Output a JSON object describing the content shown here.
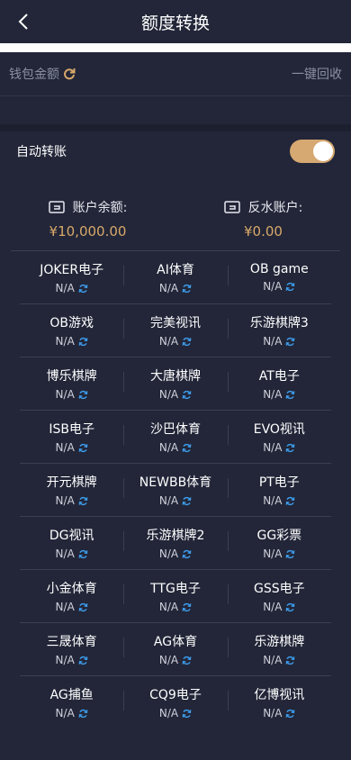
{
  "header": {
    "title": "额度转换"
  },
  "wallet": {
    "label": "钱包金额",
    "recycle": "一键回收"
  },
  "auto_transfer": {
    "label": "自动转账",
    "enabled": true
  },
  "accounts": [
    {
      "label": "账户余额:",
      "value": "¥10,000.00"
    },
    {
      "label": "反水账户:",
      "value": "¥0.00"
    }
  ],
  "colors": {
    "accent": "#d9a86a",
    "toggle": "#d6a872",
    "refresh_icon": "#3d9be9",
    "background": "#222638"
  },
  "platforms": [
    [
      {
        "name": "JOKER电子",
        "value": "N/A"
      },
      {
        "name": "AI体育",
        "value": "N/A"
      },
      {
        "name": "OB game",
        "value": "N/A"
      }
    ],
    [
      {
        "name": "OB游戏",
        "value": "N/A"
      },
      {
        "name": "完美视讯",
        "value": "N/A"
      },
      {
        "name": "乐游棋牌3",
        "value": "N/A"
      }
    ],
    [
      {
        "name": "博乐棋牌",
        "value": "N/A"
      },
      {
        "name": "大唐棋牌",
        "value": "N/A"
      },
      {
        "name": "AT电子",
        "value": "N/A"
      }
    ],
    [
      {
        "name": "ISB电子",
        "value": "N/A"
      },
      {
        "name": "沙巴体育",
        "value": "N/A"
      },
      {
        "name": "EVO视讯",
        "value": "N/A"
      }
    ],
    [
      {
        "name": "开元棋牌",
        "value": "N/A"
      },
      {
        "name": "NEWBB体育",
        "value": "N/A"
      },
      {
        "name": "PT电子",
        "value": "N/A"
      }
    ],
    [
      {
        "name": "DG视讯",
        "value": "N/A"
      },
      {
        "name": "乐游棋牌2",
        "value": "N/A"
      },
      {
        "name": "GG彩票",
        "value": "N/A"
      }
    ],
    [
      {
        "name": "小金体育",
        "value": "N/A"
      },
      {
        "name": "TTG电子",
        "value": "N/A"
      },
      {
        "name": "GSS电子",
        "value": "N/A"
      }
    ],
    [
      {
        "name": "三晟体育",
        "value": "N/A"
      },
      {
        "name": "AG体育",
        "value": "N/A"
      },
      {
        "name": "乐游棋牌",
        "value": "N/A"
      }
    ],
    [
      {
        "name": "AG捕鱼",
        "value": "N/A"
      },
      {
        "name": "CQ9电子",
        "value": "N/A"
      },
      {
        "name": "亿博视讯",
        "value": "N/A"
      }
    ]
  ]
}
